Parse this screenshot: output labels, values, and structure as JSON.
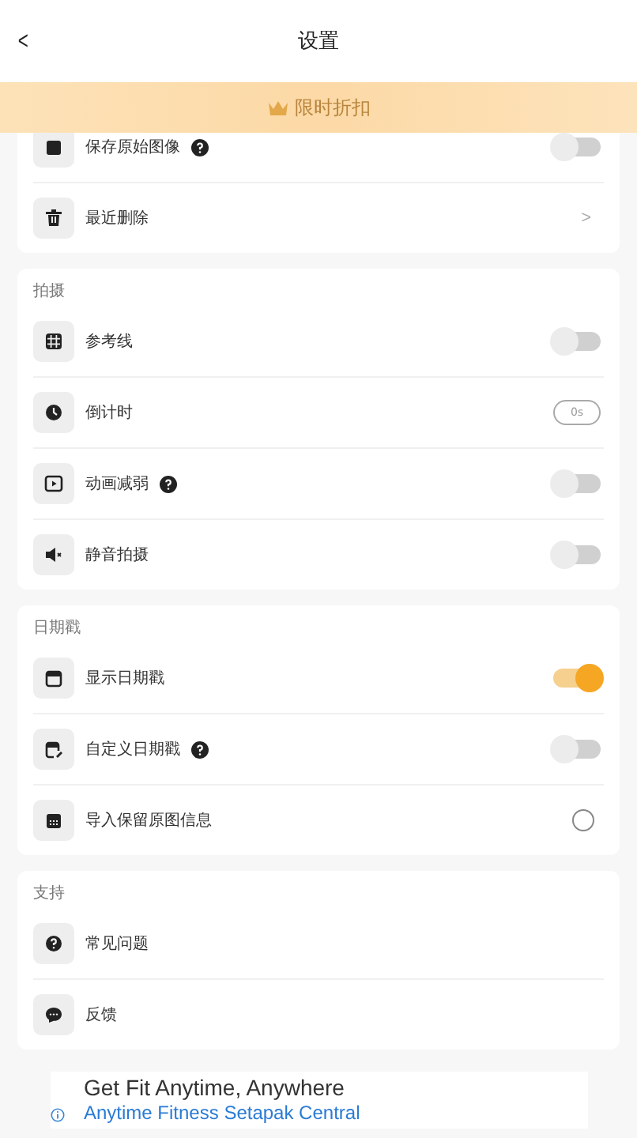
{
  "header": {
    "back": "<",
    "title": "设置"
  },
  "promo": {
    "label": "限时折扣"
  },
  "sections": [
    {
      "rows": [
        {
          "kind": "toggle",
          "label": "保存原始图像",
          "help": true,
          "on": false
        },
        {
          "kind": "chevron",
          "label": "最近删除",
          "help": false,
          "chevron": ">"
        }
      ]
    },
    {
      "title": "拍摄",
      "rows": [
        {
          "kind": "toggle",
          "label": "参考线",
          "help": false,
          "on": false
        },
        {
          "kind": "pill",
          "label": "倒计时",
          "help": false,
          "value": "0s"
        },
        {
          "kind": "toggle",
          "label": "动画减弱",
          "help": true,
          "on": false
        },
        {
          "kind": "toggle",
          "label": "静音拍摄",
          "help": false,
          "on": false
        }
      ]
    },
    {
      "title": "日期戳",
      "rows": [
        {
          "kind": "toggle",
          "label": "显示日期戳",
          "help": false,
          "on": true
        },
        {
          "kind": "toggle",
          "label": "自定义日期戳",
          "help": true,
          "on": false
        },
        {
          "kind": "radio",
          "label": "导入保留原图信息",
          "help": false,
          "checked": false
        }
      ]
    },
    {
      "title": "支持",
      "rows": [
        {
          "kind": "plain",
          "label": "常见问题",
          "help": false
        },
        {
          "kind": "plain",
          "label": "反馈",
          "help": false
        }
      ]
    }
  ],
  "ad": {
    "headline": "Get Fit Anytime, Anywhere",
    "link": "Anytime Fitness Setapak Central"
  }
}
